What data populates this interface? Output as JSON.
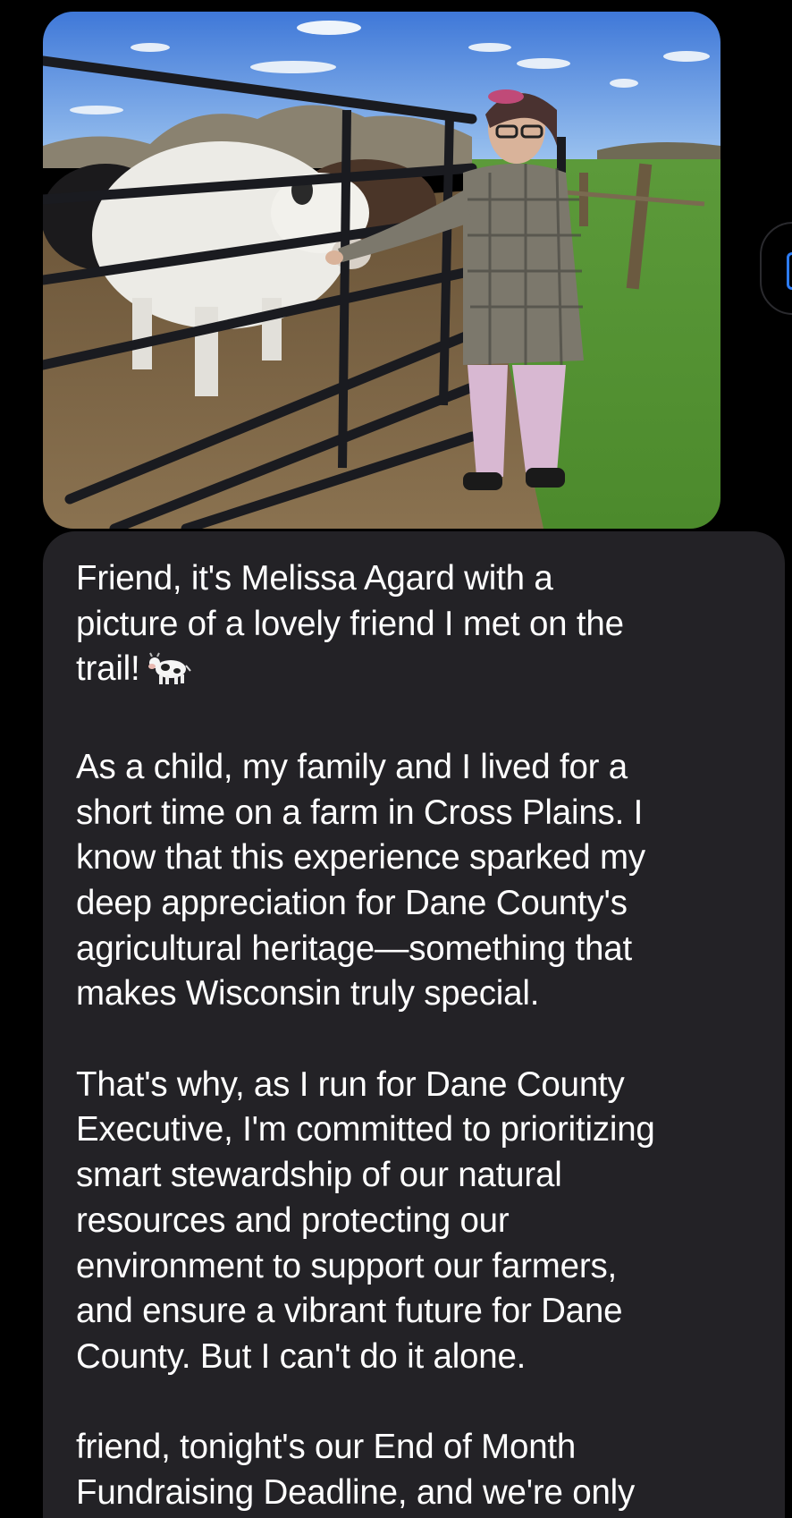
{
  "photo": {
    "kind": "attached-image",
    "subject": "photo-attachment"
  },
  "message": {
    "paragraphs": [
      "Friend, it's Melissa Agard with a\npicture of a lovely friend I met on the\ntrail!",
      "As a child, my family and I lived for a\nshort time on a farm in Cross Plains. I\nknow that this experience sparked my\ndeep appreciation for Dane County's\nagricultural heritage—something that\nmakes Wisconsin truly special.",
      "That's why, as I run for Dane County\nExecutive, I'm committed to prioritizing\nsmart stewardship of our natural\nresources and protecting our\nenvironment to support our farmers,\nand ensure a vibrant future for Dane\nCounty. But I can't do it alone.",
      "friend, tonight's our End of Month\nFundraising Deadline, and we're only"
    ],
    "emoji": "cow-icon"
  },
  "colors": {
    "background": "#000000",
    "bubble": "#232226",
    "text": "#ffffff",
    "accent": "#2d7cf6"
  }
}
